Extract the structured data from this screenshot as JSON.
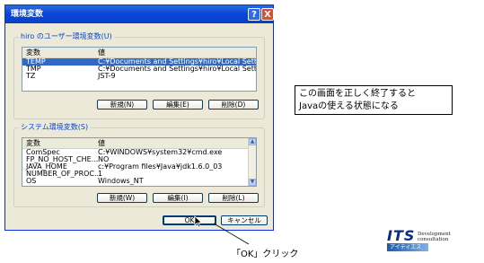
{
  "dialog": {
    "title": "環境変数",
    "help_label": "?",
    "close_label": "X",
    "user_group": {
      "label": "hiro のユーザー環境変数(U)",
      "col_var": "変数",
      "col_val": "値",
      "rows": [
        {
          "name": "TEMP",
          "value": "C:¥Documents and Settings¥hiro¥Local Settin..."
        },
        {
          "name": "TMP",
          "value": "C:¥Documents and Settings¥hiro¥Local Settin..."
        },
        {
          "name": "TZ",
          "value": "JST-9"
        }
      ],
      "new_label": "新規(N)",
      "edit_label": "編集(E)",
      "delete_label": "削除(D)"
    },
    "system_group": {
      "label": "システム環境変数(S)",
      "col_var": "変数",
      "col_val": "値",
      "rows": [
        {
          "name": "ComSpec",
          "value": "C:¥WINDOWS¥system32¥cmd.exe"
        },
        {
          "name": "FP_NO_HOST_CHE...",
          "value": "NO"
        },
        {
          "name": "JAVA_HOME",
          "value": "c:¥Program files¥Java¥jdk1.6.0_03"
        },
        {
          "name": "NUMBER_OF_PROC...",
          "value": "1"
        },
        {
          "name": "OS",
          "value": "Windows_NT"
        }
      ],
      "new_label": "新規(W)",
      "edit_label": "編集(I)",
      "delete_label": "削除(L)"
    },
    "ok_label": "OK",
    "cancel_label": "キャンセル"
  },
  "callout": {
    "line1": "この画面を正しく終了すると",
    "line2": "Javaの使える状態になる"
  },
  "caption": "「OK」クリック",
  "logo": {
    "its": "ITS",
    "dev": "Development consultation",
    "sub": "アイティエス"
  },
  "colors": {
    "titlebar": "#0A46D8",
    "dialog_bg": "#ECE9D8",
    "selection": "#316AC5",
    "group_label": "#0046D5"
  }
}
